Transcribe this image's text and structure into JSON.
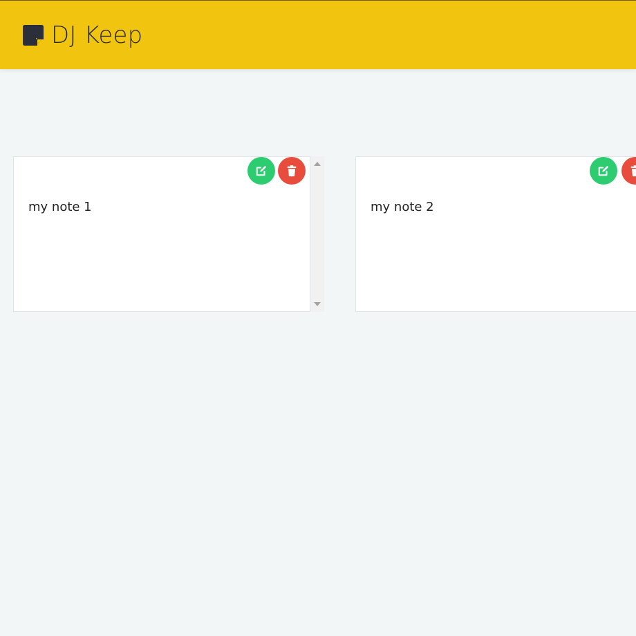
{
  "app": {
    "title": "DJ Keep",
    "icon": "sticky-note-icon",
    "header_color": "#f1c40f"
  },
  "notes": [
    {
      "text": "my note 1",
      "edit_icon": "edit-icon",
      "delete_icon": "trash-icon"
    },
    {
      "text": "my note 2",
      "edit_icon": "edit-icon",
      "delete_icon": "trash-icon"
    }
  ],
  "colors": {
    "edit": "#2ecc71",
    "delete": "#e74c3c",
    "background": "#f3f6f7"
  }
}
